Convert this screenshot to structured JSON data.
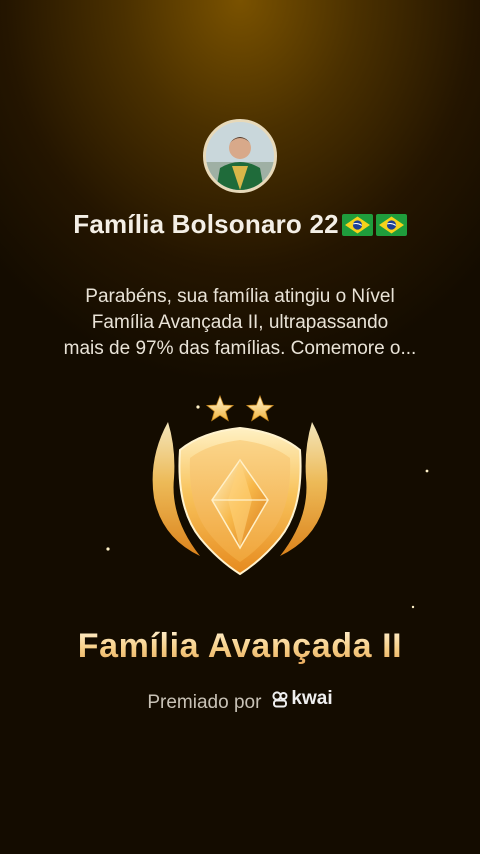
{
  "family": {
    "name": "Família Bolsonaro 22",
    "flag_icons": [
      "brazil-flag-icon",
      "brazil-flag-icon"
    ]
  },
  "message": {
    "line1": "Parabéns, sua família atingiu o Nível",
    "line2": "Família Avançada II, ultrapassando",
    "line3": "mais de 97% das famílias. Comemore o..."
  },
  "badge": {
    "icon": "shield-gem-badge-icon",
    "stars": 2
  },
  "level": {
    "name": "Família Avançada II"
  },
  "footer": {
    "awarded_by": "Premiado por",
    "brand": "kwai",
    "brand_icon": "kwai-logo-icon"
  },
  "colors": {
    "background_top": "#7a5200",
    "background_bottom": "#140c00",
    "title_gold": "#f7cf86"
  }
}
